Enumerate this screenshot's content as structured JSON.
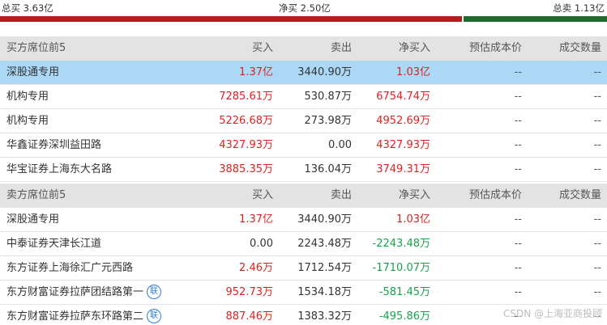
{
  "summary": {
    "total_buy": "总买 3.63亿",
    "net_buy": "净买 2.50亿",
    "total_sell": "总卖 1.13亿"
  },
  "buy_section": {
    "header": [
      "买方席位前5",
      "买入",
      "卖出",
      "净买入",
      "预估成本价",
      "成交数量"
    ],
    "rows": [
      {
        "name": "深股通专用",
        "buy": "1.37亿",
        "sell": "3440.90万",
        "net": "1.03亿",
        "cost": "--",
        "volume": "--"
      },
      {
        "name": "机构专用",
        "buy": "7285.61万",
        "sell": "530.87万",
        "net": "6754.74万",
        "cost": "--",
        "volume": "--"
      },
      {
        "name": "机构专用",
        "buy": "5226.68万",
        "sell": "273.98万",
        "net": "4952.69万",
        "cost": "--",
        "volume": "--"
      },
      {
        "name": "华鑫证券深圳益田路",
        "buy": "4327.93万",
        "sell": "0.00",
        "net": "4327.93万",
        "cost": "--",
        "volume": "--"
      },
      {
        "name": "华宝证券上海东大名路",
        "buy": "3885.35万",
        "sell": "136.04万",
        "net": "3749.31万",
        "cost": "--",
        "volume": "--"
      }
    ]
  },
  "sell_section": {
    "header": [
      "卖方席位前5",
      "买入",
      "卖出",
      "净买入",
      "预估成本价",
      "成交数量"
    ],
    "rows": [
      {
        "name": "深股通专用",
        "buy": "1.37亿",
        "sell": "3440.90万",
        "net": "1.03亿",
        "cost": "--",
        "volume": "--"
      },
      {
        "name": "中泰证券天津长江道",
        "buy": "0.00",
        "sell": "2243.48万",
        "net": "-2243.48万",
        "cost": "--",
        "volume": "--"
      },
      {
        "name": "东方证券上海徐汇广元西路",
        "buy": "2.46万",
        "sell": "1712.54万",
        "net": "-1710.07万",
        "cost": "--",
        "volume": "--"
      },
      {
        "name": "东方财富证券拉萨团结路第一",
        "buy": "952.73万",
        "sell": "1534.18万",
        "net": "-581.45万",
        "cost": "--",
        "volume": "--"
      },
      {
        "name": "东方财富证券拉萨东环路第二",
        "buy": "887.46万",
        "sell": "1383.32万",
        "net": "-495.86万",
        "cost": "--",
        "volume": "--"
      }
    ],
    "lian_badge": "联"
  },
  "watermark": "CSDN @上海亚商投顾",
  "colors": {
    "buy_bar": "#b71c1c",
    "sell_bar": "#1f6b2e",
    "highlight": "#aad8f5",
    "up": "#e02020",
    "down": "#16a34a"
  }
}
